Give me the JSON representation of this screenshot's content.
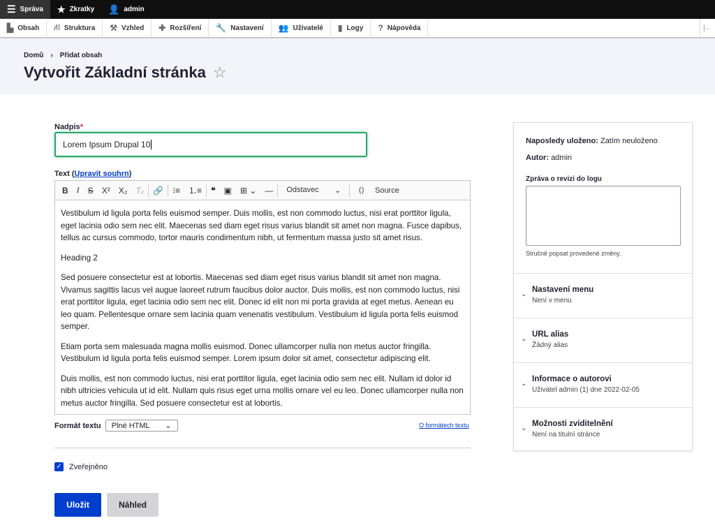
{
  "toolbar": {
    "items": [
      {
        "label": "Správa",
        "icon": "menu-icon"
      },
      {
        "label": "Zkratky",
        "icon": "star-icon"
      },
      {
        "label": "admin",
        "icon": "user-icon"
      }
    ]
  },
  "tray": {
    "items": [
      {
        "label": "Obsah",
        "icon": "▙"
      },
      {
        "label": "Struktura",
        "icon": "⛙"
      },
      {
        "label": "Vzhled",
        "icon": "⚒"
      },
      {
        "label": "Rozšíření",
        "icon": "✚"
      },
      {
        "label": "Nastavení",
        "icon": "🔧"
      },
      {
        "label": "Uživatelé",
        "icon": "👥"
      },
      {
        "label": "Logy",
        "icon": "▮"
      },
      {
        "label": "Nápověda",
        "icon": "?"
      }
    ]
  },
  "breadcrumb": [
    "Domů",
    "Přidat obsah"
  ],
  "page_title": "Vytvořit Základní stránka",
  "form": {
    "title_label": "Nadpis",
    "title_value": "Lorem Ipsum Drupal 10",
    "body_label": "Text (",
    "body_link": "Upravit souhrn",
    "body_label_end": ")",
    "editor": {
      "format_dropdown": "Odstavec",
      "source": "Source",
      "paragraphs": [
        "Vestibulum id ligula porta felis euismod semper. Duis mollis, est non commodo luctus, nisi erat porttitor ligula, eget lacinia odio sem nec elit. Maecenas sed diam eget risus varius blandit sit amet non magna. Fusce dapibus, tellus ac cursus commodo, tortor mauris condimentum nibh, ut fermentum massa justo sit amet risus.",
        "Heading 2",
        "Sed posuere consectetur est at lobortis. Maecenas sed diam eget risus varius blandit sit amet non magna. Vivamus sagittis lacus vel augue laoreet rutrum faucibus dolor auctor. Duis mollis, est non commodo luctus, nisi erat porttitor ligula, eget lacinia odio sem nec elit. Donec id elit non mi porta gravida at eget metus. Aenean eu leo quam. Pellentesque ornare sem lacinia quam venenatis vestibulum. Vestibulum id ligula porta felis euismod semper.",
        "Etiam porta sem malesuada magna mollis euismod. Donec ullamcorper nulla non metus auctor fringilla. Vestibulum id ligula porta felis euismod semper. Lorem ipsum dolor sit amet, consectetur adipiscing elit.",
        "Duis mollis, est non commodo luctus, nisi erat porttitor ligula, eget lacinia odio sem nec elit. Nullam id dolor id nibh ultricies vehicula ut id elit. Nullam quis risus eget urna mollis ornare vel eu leo. Donec ullamcorper nulla non metus auctor fringilla. Sed posuere consectetur est at lobortis."
      ]
    },
    "format_label": "Formát textu",
    "format_value": "Plné HTML",
    "format_help": "O formátech textu",
    "published_label": "Zveřejněno",
    "published": true,
    "save": "Uložit",
    "preview": "Náhled"
  },
  "sidebar": {
    "last_saved_label": "Naposledy uloženo:",
    "last_saved_value": "Zatím neuloženo",
    "author_label": "Autor:",
    "author_value": "admin",
    "revision_label": "Zpráva o revizi do logu",
    "revision_help": "Stručně popsat provedené změny.",
    "sections": [
      {
        "title": "Nastavení menu",
        "summary": "Není v menu"
      },
      {
        "title": "URL alias",
        "summary": "Žádný alias"
      },
      {
        "title": "Informace o autorovi",
        "summary": "Uživatel admin (1) dne 2022-02-05"
      },
      {
        "title": "Možnosti zviditelnění",
        "summary": "Není na titulní stránce"
      }
    ]
  },
  "colors": {
    "accent": "#003ecc",
    "focus": "#26a769"
  }
}
